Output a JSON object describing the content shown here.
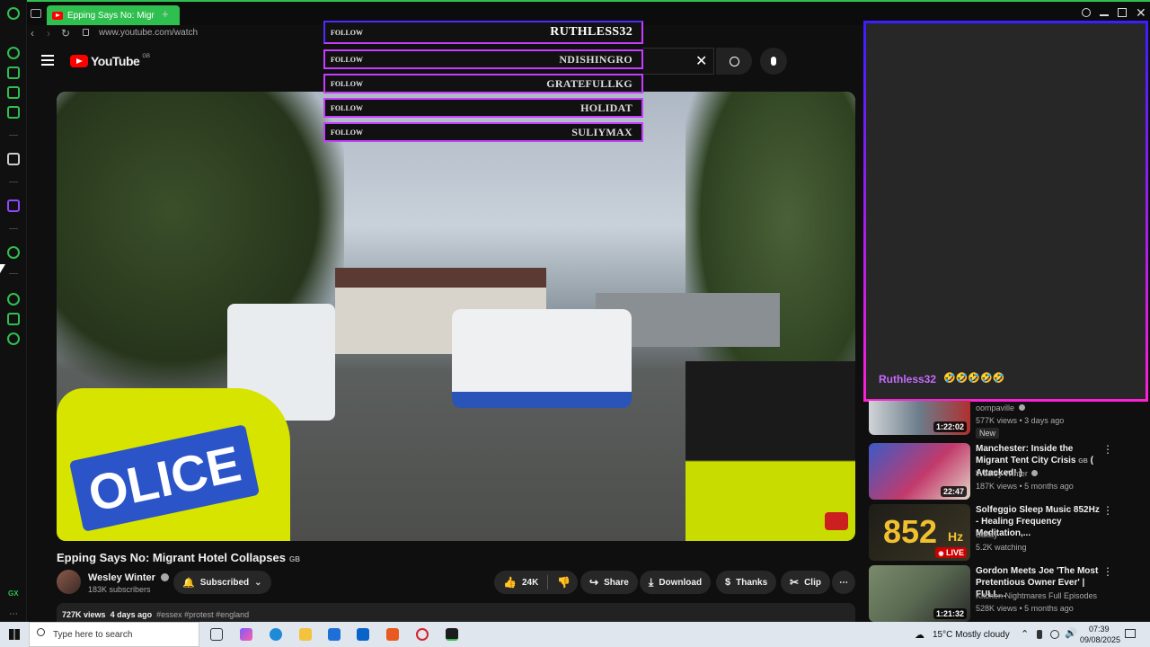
{
  "browser": {
    "tab_title": "Epping Says No: Migr",
    "new_tab": "+",
    "url": "www.youtube.com/watch",
    "sidebar_bottom": "GX"
  },
  "youtube": {
    "logo_text": "YouTube",
    "region": "GB"
  },
  "follow_overlay": {
    "items": [
      {
        "label": "FOLLOW",
        "name": "RUTHLESS32"
      },
      {
        "label": "FOLLOW",
        "name": "NDISHINGRO"
      },
      {
        "label": "FOLLOW",
        "name": "GRATEFULLKG"
      },
      {
        "label": "FOLLOW",
        "name": "HOLIDAT"
      },
      {
        "label": "FOLLOW",
        "name": "SULIYMAX"
      }
    ]
  },
  "chat_overlay": {
    "username": "Ruthless32",
    "emotes": "🤣🤣🤣🤣🤣"
  },
  "video": {
    "title": "Epping Says No: Migrant Hotel Collapses",
    "title_badge": "GB",
    "channel": "Wesley Winter",
    "subscribers": "183K subscribers",
    "subscribed_label": "Subscribed",
    "likes": "24K",
    "share_label": "Share",
    "download_label": "Download",
    "thanks_label": "Thanks",
    "clip_label": "Clip",
    "views": "727K views",
    "age": "4 days ago",
    "hashtags": "#essex #protest #england"
  },
  "recommendations": [
    {
      "title": "",
      "channel": "oompaville",
      "meta": "577K views • 3 days ago",
      "badge": "New",
      "duration": "1:22:02",
      "thumb_color": "#6b7c8a"
    },
    {
      "title": "Manchester: Inside the Migrant Tent City Crisis",
      "title_badge": "GB",
      "title_tail": "( Attacked! )",
      "channel": "Wesley Winter",
      "meta": "187K views • 5 months ago",
      "duration": "22:47",
      "thumb_color": "#c23a6b"
    },
    {
      "title": "Solfeggio Sleep Music 852Hz - Healing Frequency Meditation,...",
      "channel": "Sallay",
      "meta": "5.2K watching",
      "thumb_number": "852",
      "thumb_unit": "Hz",
      "live_label": "LIVE",
      "thumb_color": "#2b2a24"
    },
    {
      "title": "Gordon Meets Joe 'The Most Pretentious Owner Ever' | FULL...",
      "channel": "Kitchen Nightmares Full Episodes",
      "meta": "528K views • 5 months ago",
      "duration": "1:21:32",
      "thumb_color": "#5a6a52"
    }
  ],
  "taskbar": {
    "search_placeholder": "Type here to search",
    "weather": "15°C  Mostly cloudy",
    "time": "07:39",
    "date": "09/08/2025"
  },
  "colors": {
    "opera_green": "#2fbf4f",
    "youtube_red": "#ff0000",
    "overlay_purple": "#c83cff",
    "chat_name": "#c36bff"
  }
}
